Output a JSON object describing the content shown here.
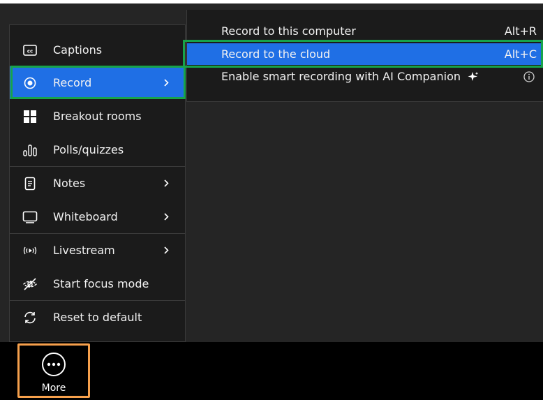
{
  "main_menu": {
    "items": [
      {
        "label": "Captions",
        "icon": "captions-icon",
        "has_submenu": false
      },
      {
        "label": "Record",
        "icon": "record-icon",
        "has_submenu": true,
        "active": true
      },
      {
        "label": "Breakout rooms",
        "icon": "breakout-rooms-icon",
        "has_submenu": false
      },
      {
        "label": "Polls/quizzes",
        "icon": "polls-icon",
        "has_submenu": false
      },
      {
        "label": "Notes",
        "icon": "notes-icon",
        "has_submenu": true
      },
      {
        "label": "Whiteboard",
        "icon": "whiteboard-icon",
        "has_submenu": true
      },
      {
        "label": "Livestream",
        "icon": "livestream-icon",
        "has_submenu": true
      },
      {
        "label": "Start focus mode",
        "icon": "focus-mode-icon",
        "has_submenu": false
      },
      {
        "label": "Reset to default",
        "icon": "reset-icon",
        "has_submenu": false
      }
    ]
  },
  "record_submenu": {
    "items": [
      {
        "label": "Record to this computer",
        "shortcut": "Alt+R"
      },
      {
        "label": "Record to the cloud",
        "shortcut": "Alt+C",
        "active": true
      },
      {
        "label": "Enable smart recording with AI Companion",
        "icon": "sparkle-icon",
        "trailing_icon": "info-icon"
      }
    ]
  },
  "toolbar": {
    "more_label": "More",
    "more_icon": "more-ellipsis-icon"
  },
  "colors": {
    "highlight_blue": "#1f6fe5",
    "annotation_green": "#17a34a",
    "annotation_orange": "#f6a04c",
    "menu_bg": "#1b1b1b"
  }
}
